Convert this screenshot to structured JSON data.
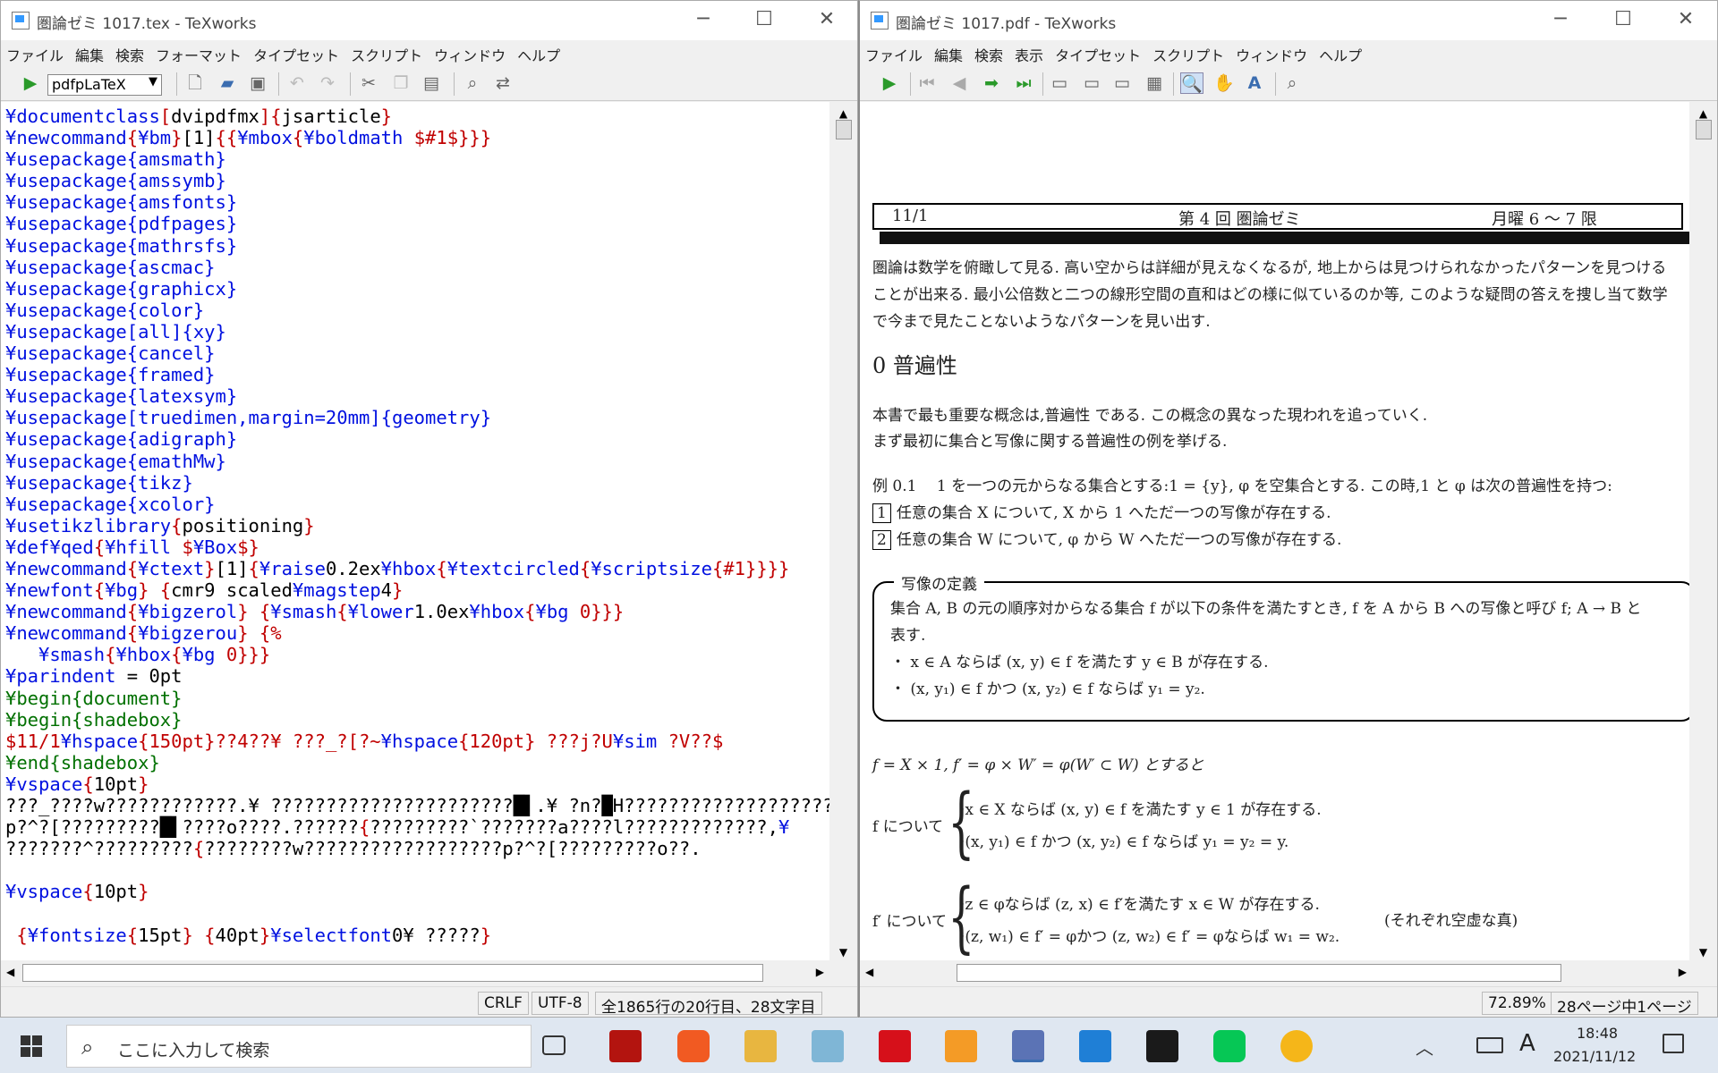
{
  "left_window": {
    "title": "圏論ゼミ 1017.tex - TeXworks",
    "menu": [
      "ファイル",
      "編集",
      "検索",
      "フォーマット",
      "タイプセット",
      "スクリプト",
      "ウィンドウ",
      "ヘルプ"
    ],
    "engine": "pdfpLaTeX",
    "status": {
      "eol": "CRLF",
      "encoding": "UTF-8",
      "position": "全1865行の20行目、28文字目"
    }
  },
  "editor_lines": [
    [
      [
        "kw",
        "¥documentclass"
      ],
      [
        "br",
        "["
      ],
      [
        "",
        "dvipdfmx"
      ],
      [
        "br",
        "]"
      ],
      [
        "br",
        "{"
      ],
      [
        "",
        "jsarticle"
      ],
      [
        "br",
        "}"
      ]
    ],
    [
      [
        "kw",
        "¥newcommand"
      ],
      [
        "br",
        "{"
      ],
      [
        "kw",
        "¥bm"
      ],
      [
        "br",
        "}"
      ],
      [
        "",
        "[1]"
      ],
      [
        "br",
        "{{"
      ],
      [
        "kw",
        "¥mbox"
      ],
      [
        "br",
        "{"
      ],
      [
        "kw",
        "¥boldmath"
      ],
      [
        "br",
        " $#1$"
      ],
      [
        "br",
        "}}}"
      ]
    ],
    [
      [
        "kw",
        "¥usepackage"
      ],
      [
        "kw",
        "{amsmath}"
      ]
    ],
    [
      [
        "kw",
        "¥usepackage"
      ],
      [
        "kw",
        "{amssymb}"
      ]
    ],
    [
      [
        "kw",
        "¥usepackage"
      ],
      [
        "kw",
        "{amsfonts}"
      ]
    ],
    [
      [
        "kw",
        "¥usepackage"
      ],
      [
        "kw",
        "{pdfpages}"
      ]
    ],
    [
      [
        "kw",
        "¥usepackage"
      ],
      [
        "kw",
        "{mathrsfs}"
      ]
    ],
    [
      [
        "kw",
        "¥usepackage"
      ],
      [
        "kw",
        "{ascmac}"
      ]
    ],
    [
      [
        "kw",
        "¥usepackage"
      ],
      [
        "kw",
        "{graphicx}"
      ]
    ],
    [
      [
        "kw",
        "¥usepackage"
      ],
      [
        "kw",
        "{color}"
      ]
    ],
    [
      [
        "kw",
        "¥usepackage"
      ],
      [
        "kw",
        "[all]{xy}"
      ]
    ],
    [
      [
        "kw",
        "¥usepackage"
      ],
      [
        "kw",
        "{cancel}"
      ]
    ],
    [
      [
        "kw",
        "¥usepackage"
      ],
      [
        "kw",
        "{framed}"
      ]
    ],
    [
      [
        "kw",
        "¥usepackage"
      ],
      [
        "kw",
        "{latexsym}"
      ]
    ],
    [
      [
        "kw",
        "¥usepackage"
      ],
      [
        "kw",
        "[truedimen,margin=20mm]{geometry}"
      ]
    ],
    [
      [
        "kw",
        "¥usepackage"
      ],
      [
        "kw",
        "{adigraph}"
      ]
    ],
    [
      [
        "kw",
        "¥usepackage"
      ],
      [
        "kw",
        "{emathMw}"
      ]
    ],
    [
      [
        "kw",
        "¥usepackage"
      ],
      [
        "kw",
        "{tikz}"
      ]
    ],
    [
      [
        "kw",
        "¥usepackage"
      ],
      [
        "kw",
        "{xcolor}"
      ]
    ],
    [
      [
        "kw",
        "¥usetikzlibrary"
      ],
      [
        "br",
        "{"
      ],
      [
        "",
        "positioning"
      ],
      [
        "br",
        "}"
      ]
    ],
    [
      [
        "kw",
        "¥def¥qed"
      ],
      [
        "br",
        "{"
      ],
      [
        "kw",
        "¥hfill"
      ],
      [
        "br",
        " $"
      ],
      [
        "kw",
        "¥Box"
      ],
      [
        "br",
        "$}"
      ]
    ],
    [
      [
        "kw",
        "¥newcommand"
      ],
      [
        "br",
        "{"
      ],
      [
        "kw",
        "¥ctext"
      ],
      [
        "br",
        "}"
      ],
      [
        "",
        "[1]"
      ],
      [
        "br",
        "{"
      ],
      [
        "kw",
        "¥raise"
      ],
      [
        "",
        "0.2ex"
      ],
      [
        "kw",
        "¥hbox"
      ],
      [
        "br",
        "{"
      ],
      [
        "kw",
        "¥textcircled"
      ],
      [
        "br",
        "{"
      ],
      [
        "kw",
        "¥scriptsize"
      ],
      [
        "br",
        "{#1}}}}"
      ]
    ],
    [
      [
        "kw",
        "¥newfont"
      ],
      [
        "br",
        "{"
      ],
      [
        "kw",
        "¥bg"
      ],
      [
        "br",
        "}"
      ],
      [
        "br",
        " {"
      ],
      [
        "",
        "cmr9 scaled"
      ],
      [
        "kw",
        "¥magstep"
      ],
      [
        "",
        "4"
      ],
      [
        "br",
        "}"
      ]
    ],
    [
      [
        "kw",
        "¥newcommand"
      ],
      [
        "br",
        "{"
      ],
      [
        "kw",
        "¥bigzerol"
      ],
      [
        "br",
        "}"
      ],
      [
        "br",
        " {"
      ],
      [
        "kw",
        "¥smash"
      ],
      [
        "br",
        "{"
      ],
      [
        "kw",
        "¥lower"
      ],
      [
        "",
        "1.0ex"
      ],
      [
        "kw",
        "¥hbox"
      ],
      [
        "br",
        "{"
      ],
      [
        "kw",
        "¥bg"
      ],
      [
        "br",
        " 0}}}"
      ]
    ],
    [
      [
        "kw",
        "¥newcommand"
      ],
      [
        "br",
        "{"
      ],
      [
        "kw",
        "¥bigzerou"
      ],
      [
        "br",
        "}"
      ],
      [
        "br",
        " {%"
      ]
    ],
    [
      [
        "",
        "   "
      ],
      [
        "kw",
        "¥smash"
      ],
      [
        "br",
        "{"
      ],
      [
        "kw",
        "¥hbox"
      ],
      [
        "br",
        "{"
      ],
      [
        "kw",
        "¥bg"
      ],
      [
        "br",
        " 0}}}"
      ]
    ],
    [
      [
        "kw",
        "¥parindent"
      ],
      [
        "",
        " = 0pt"
      ]
    ],
    [
      [
        "gr",
        "¥begin{document}"
      ]
    ],
    [
      [
        "gr",
        "¥begin{shadebox}"
      ]
    ],
    [
      [
        "br",
        "$11/1"
      ],
      [
        "kw",
        "¥hspace"
      ],
      [
        "br",
        "{150pt}??4??¥ ???_?[?~"
      ],
      [
        "kw",
        "¥hspace"
      ],
      [
        "br",
        "{120pt} ???j?U"
      ],
      [
        "kw",
        "¥sim"
      ],
      [
        "br",
        " ?V??$"
      ]
    ],
    [
      [
        "gr",
        "¥end{shadebox}"
      ]
    ],
    [
      [
        "kw",
        "¥vspace"
      ],
      [
        "br",
        "{"
      ],
      [
        "",
        "10pt"
      ],
      [
        "br",
        "}"
      ]
    ],
    [
      [
        "",
        "???_????w????????????.¥ ??????????????????????█▌.¥ ?n?█H????????????????????"
      ]
    ],
    [
      [
        "",
        "p?^?[?????????█▌????o????.??????"
      ],
      [
        "br",
        "{"
      ],
      [
        "",
        "?????????`???????a????l?????????????,"
      ],
      [
        "kw",
        "¥"
      ]
    ],
    [
      [
        "",
        "???????^?????????"
      ],
      [
        "br",
        "{"
      ],
      [
        "",
        "????????w??????????????????p?^?[?????????o??."
      ]
    ],
    [
      [
        "",
        ""
      ]
    ],
    [
      [
        "kw",
        "¥vspace"
      ],
      [
        "br",
        "{"
      ],
      [
        "",
        "10pt"
      ],
      [
        "br",
        "}"
      ]
    ],
    [
      [
        "",
        ""
      ]
    ],
    [
      [
        "br",
        " {"
      ],
      [
        "kw",
        "¥fontsize"
      ],
      [
        "br",
        "{"
      ],
      [
        "",
        "15pt"
      ],
      [
        "br",
        "} {"
      ],
      [
        "",
        "40pt"
      ],
      [
        "br",
        "}"
      ],
      [
        "kw",
        "¥selectfont"
      ],
      [
        "",
        "0¥ ?????"
      ],
      [
        "br",
        "}"
      ]
    ]
  ],
  "right_window": {
    "title": "圏論ゼミ 1017.pdf - TeXworks",
    "menu": [
      "ファイル",
      "編集",
      "検索",
      "表示",
      "タイプセット",
      "スクリプト",
      "ウィンドウ",
      "ヘルプ"
    ],
    "status": {
      "zoom": "72.89%",
      "page": "28ページ中1ページ"
    }
  },
  "pdf": {
    "header": {
      "date": "11/1",
      "title": "第 4 回 圏論ゼミ",
      "time": "月曜 6 ～ 7 限"
    },
    "intro": [
      "圏論は数学を俯瞰して見る. 高い空からは詳細が見えなくなるが, 地上からは見つけられなかったパターンを見つける",
      "ことが出来る. 最小公倍数と二つの線形空間の直和はどの様に似ているのか等, このような疑問の答えを捜し当て数学",
      "で今まで見たことないようなパターンを見い出す."
    ],
    "section": "0  普遍性",
    "p1": "本書で最も重要な概念は,普遍性 である. この概念の異なった現われを追っていく.",
    "p2": "まず最初に集合と写像に関する普遍性の例を挙げる.",
    "ex": "例 0.1　 1 を一つの元からなる集合とする:1 = {y}, φ を空集合とする. この時,1 と φ は次の普遍性を持つ:",
    "items": [
      [
        "1",
        "任意の集合 X について, X から 1 へただ一つの写像が存在する."
      ],
      [
        "2",
        "任意の集合 W について, φ から W へただ一つの写像が存在する."
      ]
    ],
    "box_title": "写像の定義",
    "box_lines": [
      "集合 A, B の元の順序対からなる集合 f が以下の条件を満たすとき, f を A から B への写像と呼び f; A → B と",
      "表す.",
      "・ x ∈ A ならば (x, y) ∈ f を満たす y ∈ B が存在する.",
      "・ (x, y₁) ∈ f かつ (x, y₂) ∈ f ならば y₁ = y₂."
    ],
    "eq1": "f = X × 1, f′ = φ × W′ = φ(W′ ⊂ W) とすると",
    "f_label": "f について",
    "f_lines": [
      "·x ∈ X ならば (x, y) ∈ f を満たす y ∈ 1 が存在する.",
      "·(x, y₁) ∈ f かつ (x, y₂) ∈ f ならば y₁ = y₂ = y."
    ],
    "fp_label": "f′ について",
    "fp_lines": [
      "·z ∈ φならば (z, x) ∈ f′を満たす x ∈ W が存在する.",
      "·(z, w₁) ∈ f′ = φかつ (z, w₂) ∈ f′ = φならば w₁ = w₂."
    ],
    "fp_note": "(それぞれ空虚な真)"
  },
  "taskbar": {
    "search_placeholder": "ここに入力して検索",
    "time": "18:48",
    "date": "2021/11/12",
    "ime": "A"
  }
}
